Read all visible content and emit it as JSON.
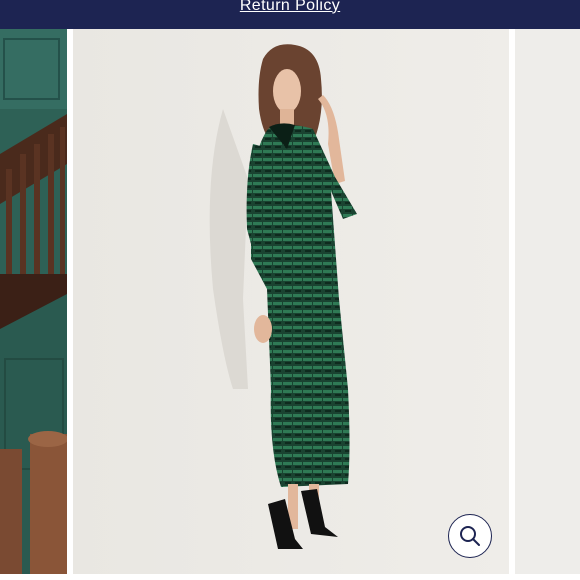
{
  "banner": {
    "link_text": "Return Policy"
  },
  "gallery": {
    "zoom_icon": "search-icon"
  },
  "colors": {
    "banner_bg": "#1d2452",
    "dress": "#1f4d38",
    "wall": "#2f6157"
  }
}
